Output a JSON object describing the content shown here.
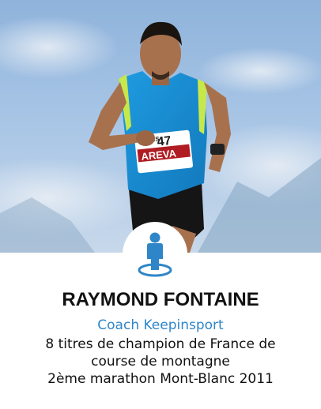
{
  "profile": {
    "photo_alt": "Runner in blue AREVA singlet",
    "badge_icon": "coach-person-icon",
    "name": "RAYMOND FONTAINE",
    "role": "Coach Keepinsport",
    "description_lines": [
      "8 titres de champion de France de",
      "course de montagne",
      "2ème marathon Mont-Blanc 2011"
    ],
    "bib_text": "AREVA",
    "bib_number": "47",
    "bib_top": "ICS"
  },
  "colors": {
    "accent": "#2e86c8",
    "name": "#111111",
    "sky": "#9fc1e3"
  }
}
